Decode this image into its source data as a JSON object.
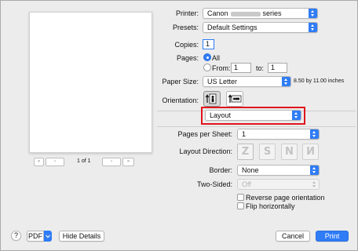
{
  "preview": {
    "page_indicator": "1 of 1",
    "nav_first": "«",
    "nav_prev": "‹",
    "nav_next": "›",
    "nav_last": "»"
  },
  "printer": {
    "label": "Printer:",
    "value_prefix": "Canon",
    "value_suffix": "series"
  },
  "presets": {
    "label": "Presets:",
    "value": "Default Settings"
  },
  "copies": {
    "label": "Copies:",
    "value": "1"
  },
  "pages": {
    "label": "Pages:",
    "all_label": "All",
    "from_label": "From:",
    "from_value": "1",
    "to_label": "to:",
    "to_value": "1",
    "selected": "All"
  },
  "paper_size": {
    "label": "Paper Size:",
    "value": "US Letter",
    "dimensions": "8.50 by 11.00 inches"
  },
  "orientation": {
    "label": "Orientation:",
    "selected": "portrait"
  },
  "section": {
    "value": "Layout"
  },
  "pages_per_sheet": {
    "label": "Pages per Sheet:",
    "value": "1"
  },
  "layout_direction": {
    "label": "Layout Direction:",
    "options": [
      "Z",
      "S",
      "N",
      "N"
    ]
  },
  "border": {
    "label": "Border:",
    "value": "None"
  },
  "two_sided": {
    "label": "Two-Sided:",
    "value": "Off"
  },
  "reverse_orientation": {
    "label": "Reverse page orientation",
    "checked": false
  },
  "flip_horizontally": {
    "label": "Flip horizontally",
    "checked": false
  },
  "footer": {
    "help": "?",
    "pdf": "PDF",
    "hide_details": "Hide Details",
    "cancel": "Cancel",
    "print": "Print"
  },
  "colors": {
    "accent": "#2f7cf6",
    "highlight_border": "#e0141c"
  }
}
